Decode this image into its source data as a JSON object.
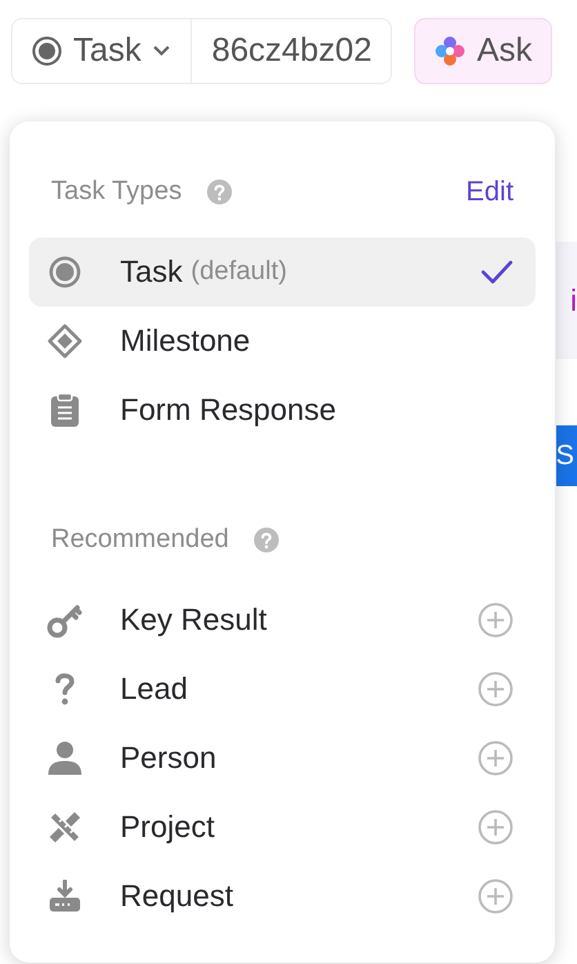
{
  "top_bar": {
    "task_type_button": {
      "label": "Task"
    },
    "task_id": "86cz4bz02",
    "ask_button": {
      "label": "Ask"
    }
  },
  "background_page": {
    "link_fragment": "i",
    "button_fragment": "S"
  },
  "menu": {
    "sections": [
      {
        "kind": "select",
        "title": "Task Types",
        "action": "Edit",
        "items": [
          {
            "label": "Task",
            "note": "(default)",
            "selected": true
          },
          {
            "label": "Milestone",
            "selected": false
          },
          {
            "label": "Form Response",
            "selected": false
          }
        ]
      },
      {
        "kind": "add",
        "title": "Recommended",
        "items": [
          {
            "label": "Key Result"
          },
          {
            "label": "Lead"
          },
          {
            "label": "Person"
          },
          {
            "label": "Project"
          },
          {
            "label": "Request"
          }
        ]
      }
    ]
  }
}
